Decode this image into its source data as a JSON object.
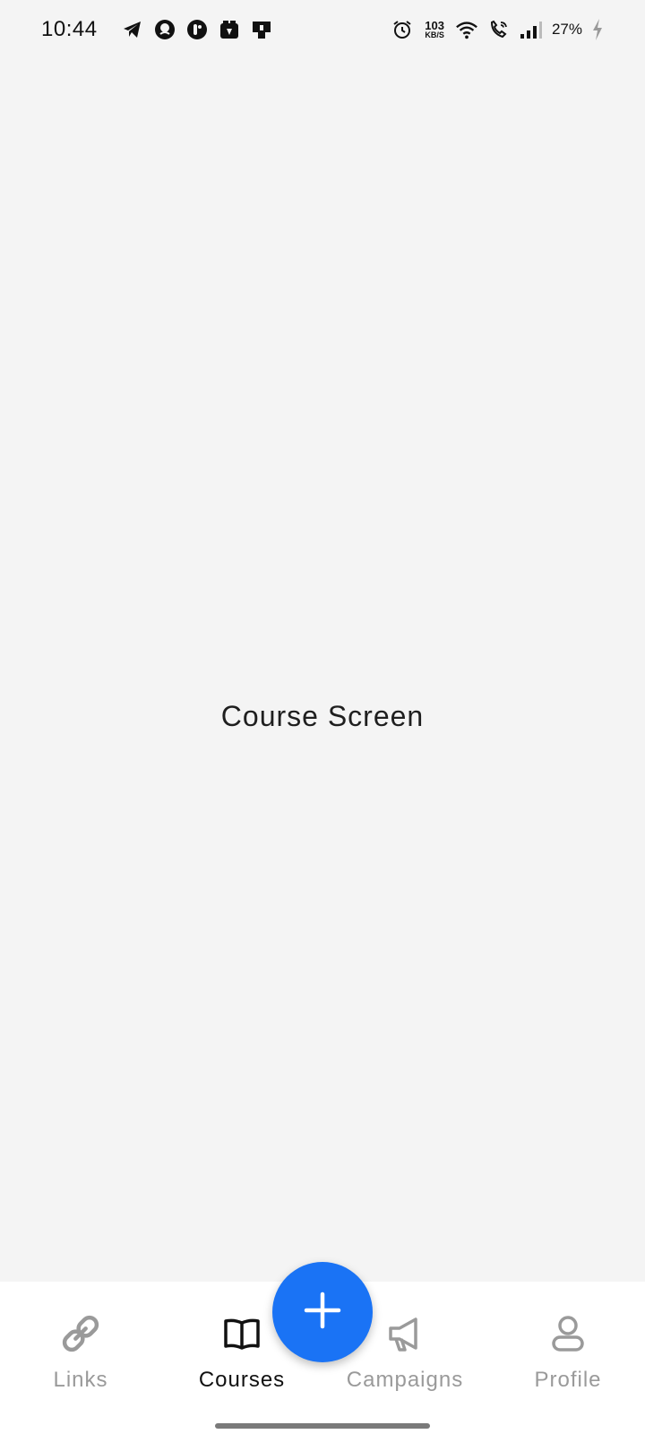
{
  "status_bar": {
    "time": "10:44",
    "left_icons": [
      "telegram-icon",
      "app-icon-1",
      "app-icon-2",
      "app-icon-3",
      "app-icon-4"
    ],
    "net_speed_value": "103",
    "net_speed_unit": "KB/S",
    "battery": "27%",
    "right_icons": [
      "alarm-icon",
      "wifi-icon",
      "wifi-call-icon",
      "signal-icon",
      "charging-icon"
    ]
  },
  "main": {
    "title": "Course Screen"
  },
  "bottom_nav": {
    "items": [
      {
        "label": "Links",
        "icon": "link-icon",
        "active": false
      },
      {
        "label": "Courses",
        "icon": "book-icon",
        "active": true
      },
      {
        "label": "Campaigns",
        "icon": "megaphone-icon",
        "active": false
      },
      {
        "label": "Profile",
        "icon": "person-icon",
        "active": false
      }
    ],
    "fab_icon": "plus-icon"
  },
  "colors": {
    "background": "#f4f4f4",
    "nav_background": "#ffffff",
    "accent": "#1a73f5",
    "inactive": "#9a9a9a",
    "active": "#111111"
  }
}
